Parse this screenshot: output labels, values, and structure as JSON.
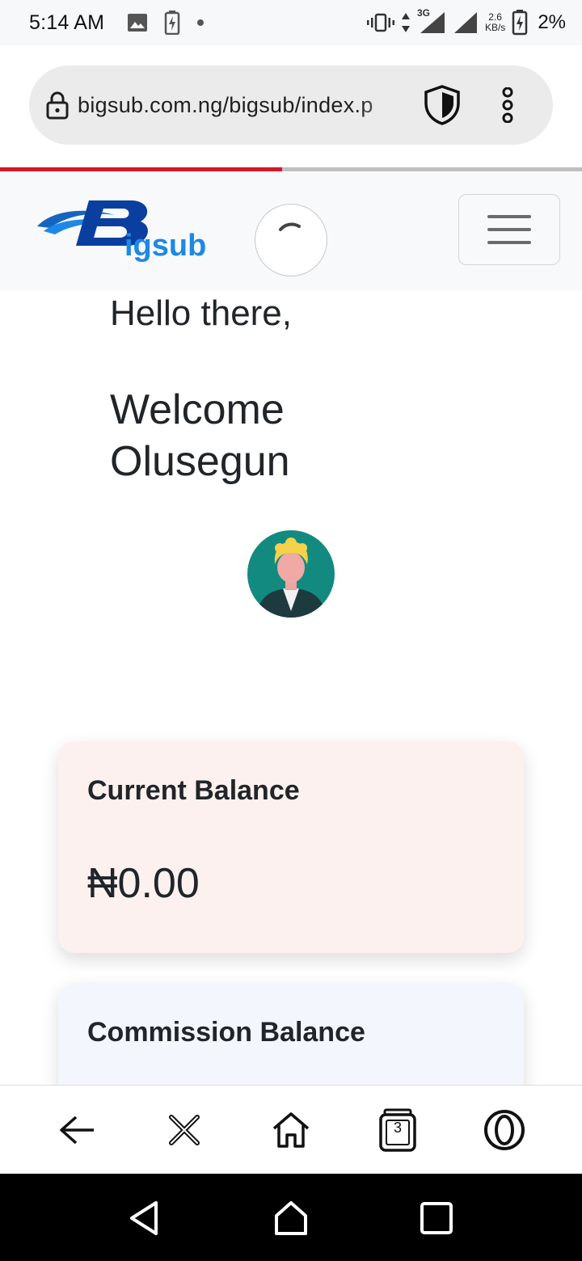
{
  "status_bar": {
    "time": "5:14 AM",
    "network": "3G",
    "speed_value": "2.6",
    "speed_unit": "KB/s",
    "battery": "2%"
  },
  "browser": {
    "url": "bigsub.com.ng/bigsub/index.p",
    "page_load_progress": 0.485,
    "tab_count": "3"
  },
  "site": {
    "logo_text": "igsub",
    "greeting": "Hello there,",
    "welcome_line": "Welcome",
    "user_name": "Olusegun"
  },
  "cards": {
    "current_balance_title": "Current Balance",
    "current_balance_value": "₦0.00",
    "commission_balance_title": "Commission Balance"
  },
  "colors": {
    "accent_red": "#d6162a",
    "logo_blue": "#0a3fa0",
    "logo_light_blue": "#1e88e5",
    "balance_card_bg": "#fcf1ef",
    "commission_card_bg": "#f3f6fc"
  },
  "icons": {
    "lock": "lock-icon",
    "shield": "shield-icon",
    "menu": "more-vert-icon",
    "back": "back-arrow-icon",
    "close": "close-icon",
    "home": "home-icon",
    "tabs": "tabs-icon",
    "opera": "opera-icon"
  }
}
